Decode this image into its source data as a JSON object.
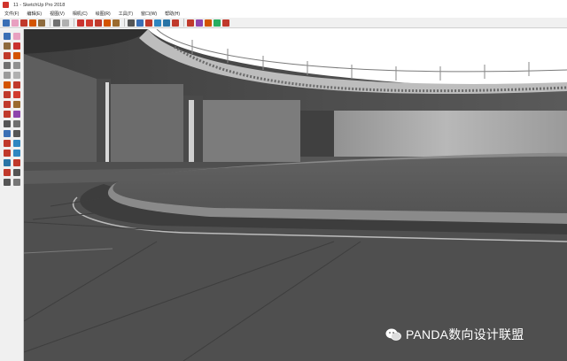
{
  "window": {
    "title": "11 - SketchUp Pro 2018"
  },
  "menu": [
    "文件(F)",
    "编辑(E)",
    "视图(V)",
    "相机(C)",
    "绘图(R)",
    "工具(T)",
    "窗口(W)",
    "帮助(H)"
  ],
  "watermark": {
    "text": "PANDA数向设计联盟"
  },
  "toolbar_icons": [
    "select-arrow",
    "eraser",
    "pencil",
    "paint-bucket",
    "rectangle",
    "circle",
    "arc",
    "push-pull",
    "move",
    "rotate",
    "scale",
    "offset",
    "tape-measure",
    "text",
    "orbit",
    "pan",
    "zoom",
    "zoom-extents",
    "warehouse",
    "extension",
    "components",
    "red-cross",
    "styles",
    "layers",
    "shadows",
    "section"
  ],
  "colors": {
    "viewport_bg": "#565656",
    "sky": "#ffffff",
    "floor": "#4f4f4f",
    "platform": "#5a5a5a",
    "platform_rim": "#8a8a8a",
    "ring_beam": "#bfbfbf",
    "wall": "#7a7a7a",
    "back_wall": "#a8a8a8"
  }
}
